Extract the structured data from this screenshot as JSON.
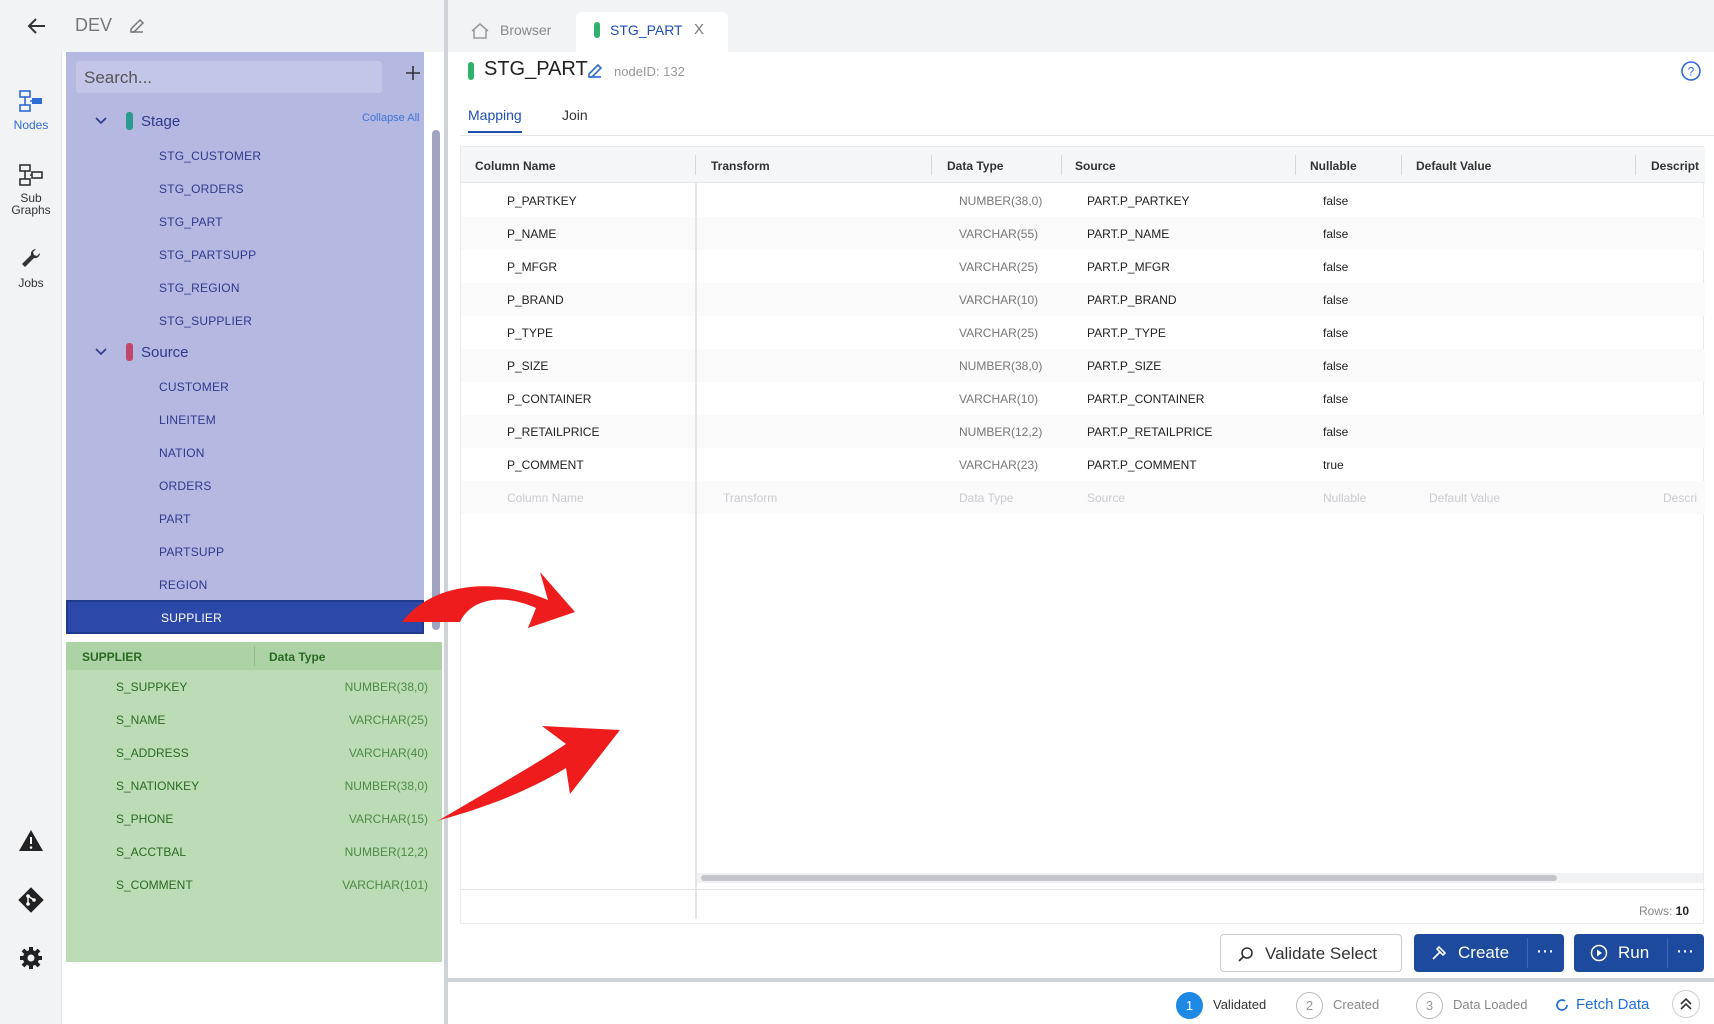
{
  "project": {
    "name": "DEV"
  },
  "rail": {
    "items": [
      {
        "label": "Nodes"
      },
      {
        "label_line1": "Sub",
        "label_line2": "Graphs"
      },
      {
        "label": "Jobs"
      }
    ]
  },
  "browser": {
    "search_placeholder": "Search...",
    "collapse_all": "Collapse All",
    "groups": [
      {
        "name": "Stage",
        "color": "#2b9a8f",
        "items": [
          "STG_CUSTOMER",
          "STG_ORDERS",
          "STG_PART",
          "STG_PARTSUPP",
          "STG_REGION",
          "STG_SUPPLIER"
        ]
      },
      {
        "name": "Source",
        "color": "#c0476b",
        "items": [
          "CUSTOMER",
          "LINEITEM",
          "NATION",
          "ORDERS",
          "PART",
          "PARTSUPP",
          "REGION",
          "SUPPLIER"
        ]
      }
    ],
    "selected": "SUPPLIER"
  },
  "columns_panel": {
    "header_name": "SUPPLIER",
    "header_type": "Data Type",
    "rows": [
      {
        "name": "S_SUPPKEY",
        "type": "NUMBER(38,0)"
      },
      {
        "name": "S_NAME",
        "type": "VARCHAR(25)"
      },
      {
        "name": "S_ADDRESS",
        "type": "VARCHAR(40)"
      },
      {
        "name": "S_NATIONKEY",
        "type": "NUMBER(38,0)"
      },
      {
        "name": "S_PHONE",
        "type": "VARCHAR(15)"
      },
      {
        "name": "S_ACCTBAL",
        "type": "NUMBER(12,2)"
      },
      {
        "name": "S_COMMENT",
        "type": "VARCHAR(101)"
      }
    ]
  },
  "tabs": {
    "browser": "Browser",
    "active": "STG_PART",
    "close": "X"
  },
  "node": {
    "title": "STG_PART",
    "node_id": "nodeID: 132"
  },
  "subtabs": {
    "mapping": "Mapping",
    "join": "Join"
  },
  "grid": {
    "headers": [
      "Column Name",
      "Transform",
      "Data Type",
      "Source",
      "Nullable",
      "Default Value",
      "Descript"
    ],
    "rows": [
      {
        "name": "P_PARTKEY",
        "type": "NUMBER(38,0)",
        "source": "PART.P_PARTKEY",
        "nullable": "false"
      },
      {
        "name": "P_NAME",
        "type": "VARCHAR(55)",
        "source": "PART.P_NAME",
        "nullable": "false"
      },
      {
        "name": "P_MFGR",
        "type": "VARCHAR(25)",
        "source": "PART.P_MFGR",
        "nullable": "false"
      },
      {
        "name": "P_BRAND",
        "type": "VARCHAR(10)",
        "source": "PART.P_BRAND",
        "nullable": "false"
      },
      {
        "name": "P_TYPE",
        "type": "VARCHAR(25)",
        "source": "PART.P_TYPE",
        "nullable": "false"
      },
      {
        "name": "P_SIZE",
        "type": "NUMBER(38,0)",
        "source": "PART.P_SIZE",
        "nullable": "false"
      },
      {
        "name": "P_CONTAINER",
        "type": "VARCHAR(10)",
        "source": "PART.P_CONTAINER",
        "nullable": "false"
      },
      {
        "name": "P_RETAILPRICE",
        "type": "NUMBER(12,2)",
        "source": "PART.P_RETAILPRICE",
        "nullable": "false"
      },
      {
        "name": "P_COMMENT",
        "type": "VARCHAR(23)",
        "source": "PART.P_COMMENT",
        "nullable": "true"
      }
    ],
    "placeholder": {
      "name": "Column Name",
      "transform": "Transform",
      "type": "Data Type",
      "source": "Source",
      "nullable": "Nullable",
      "default": "Default Value",
      "desc": "Descri"
    },
    "rows_label": "Rows:",
    "rows_count": "10"
  },
  "actions": {
    "validate": "Validate Select",
    "create": "Create",
    "run": "Run",
    "more": "⋯"
  },
  "status": {
    "steps": [
      {
        "num": "1",
        "label": "Validated"
      },
      {
        "num": "2",
        "label": "Created"
      },
      {
        "num": "3",
        "label": "Data Loaded"
      }
    ],
    "fetch": "Fetch Data"
  },
  "colors": {
    "accent": "#1d4a9c",
    "browser_bg": "#b5b8e0",
    "columns_bg": "#bcdcb6",
    "arrow": "#ee1c1c"
  }
}
